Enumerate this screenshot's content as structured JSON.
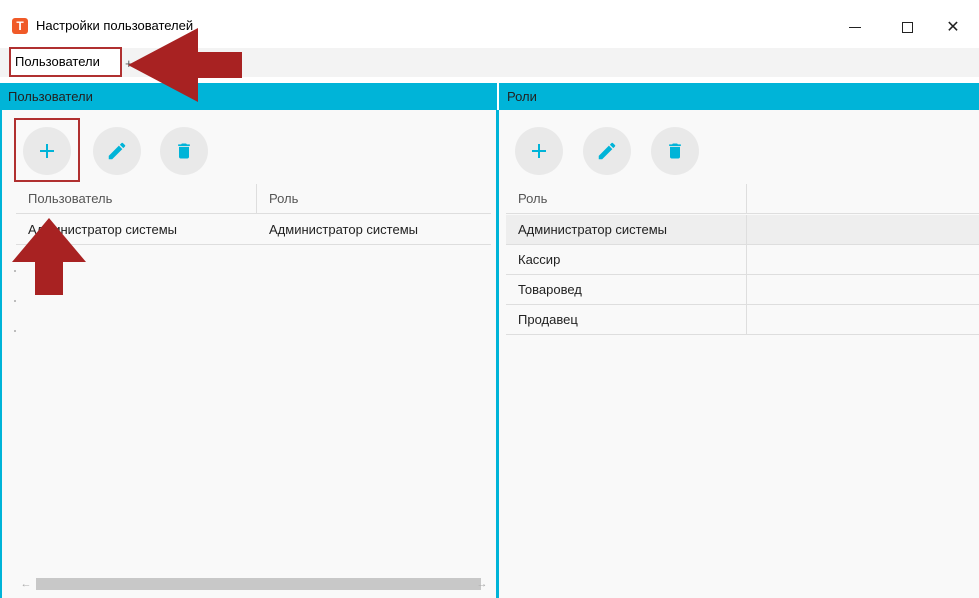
{
  "window": {
    "title": "Настройки пользователей",
    "app_icon_letter": "T",
    "controls": {
      "minimize": "—",
      "close": "✕"
    }
  },
  "menu": {
    "active_tab": "Пользователи",
    "separator": "+"
  },
  "users_panel": {
    "header": "Пользователи",
    "toolbar": [
      "add-icon",
      "edit-icon",
      "delete-icon"
    ],
    "columns": [
      "Пользователь",
      "Роль"
    ],
    "rows": [
      {
        "user": "Администратор системы",
        "role": "Администратор системы"
      }
    ],
    "scroll_left": "←",
    "scroll_right": "→"
  },
  "roles_panel": {
    "header": "Роли",
    "toolbar": [
      "add-icon",
      "edit-icon",
      "delete-icon"
    ],
    "columns": [
      "Роль"
    ],
    "rows": [
      "Администратор системы",
      "Кассир",
      "Товаровед",
      "Продавец"
    ]
  },
  "colors": {
    "accent": "#00b4d8",
    "annotation": "#b03030",
    "app_icon": "#f05a28",
    "button_bg": "#e9e9e9"
  }
}
